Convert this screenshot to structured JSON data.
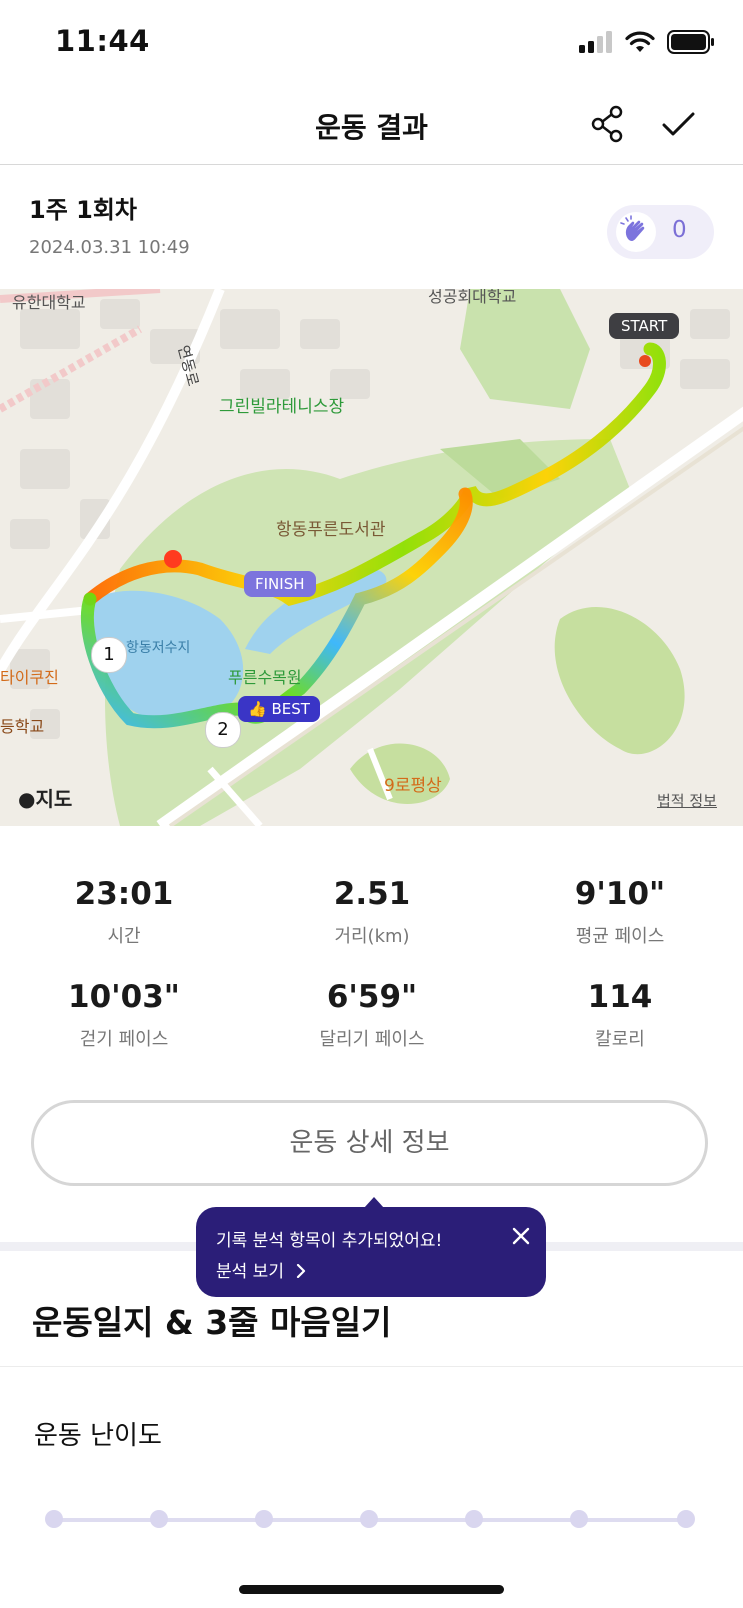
{
  "status_bar": {
    "time": "11:44"
  },
  "header": {
    "title": "운동 결과",
    "share_icon": "share-icon",
    "check_icon": "checkmark-icon"
  },
  "session": {
    "title": "1주 1회차",
    "datetime": "2024.03.31 10:49",
    "clap_count": "0"
  },
  "map": {
    "labels": {
      "start": "START",
      "finish": "FINISH",
      "best": "BEST",
      "marker_1": "1",
      "marker_2": "2",
      "poi_univ1": "유한대학교",
      "poi_univ2": "성공회대학교",
      "poi_tennis": "그린빌라테니스장",
      "poi_library": "항동푸른도서관",
      "poi_lake": "항동저수지",
      "poi_arboretum": "푸른수목원",
      "poi_cafe": "9로평상",
      "poi_left1": "타이쿠진",
      "poi_left2": "등학교",
      "road": "연동로",
      "attribution": "지도",
      "legal": "법적 정보"
    }
  },
  "stats": [
    {
      "value": "23:01",
      "label": "시간"
    },
    {
      "value": "2.51",
      "label": "거리(km)"
    },
    {
      "value": "9'10\"",
      "label": "평균 페이스"
    },
    {
      "value": "10'03\"",
      "label": "걷기 페이스"
    },
    {
      "value": "6'59\"",
      "label": "달리기 페이스"
    },
    {
      "value": "114",
      "label": "칼로리"
    }
  ],
  "detail_button": {
    "label": "운동 상세 정보"
  },
  "tooltip": {
    "message": "기록 분석 항목이 추가되었어요!",
    "link": "분석 보기"
  },
  "journal": {
    "title": "운동일지 & 3줄 마음일기",
    "difficulty_label": "운동 난이도",
    "difficulty_steps": 7
  },
  "colors": {
    "accent": "#7c74dd",
    "tooltip_bg": "#2b1e78",
    "best_badge": "#3a35c6"
  }
}
